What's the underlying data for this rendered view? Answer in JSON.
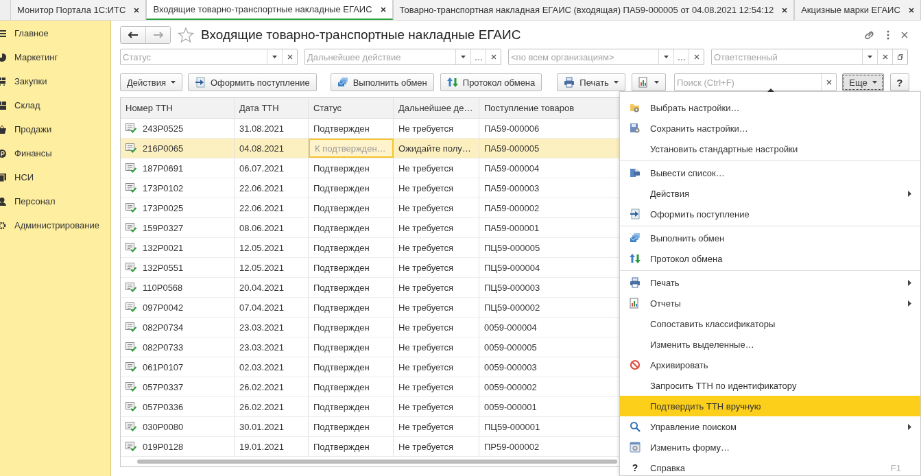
{
  "tabs": [
    {
      "label": "Монитор Портала 1С:ИТС",
      "selected": false
    },
    {
      "label": "Входящие товарно-транспортные накладные ЕГАИС",
      "selected": true
    },
    {
      "label": "Товарно-транспортная накладная ЕГАИС (входящая) ПА59-000005 от 04.08.2021 12:54:12",
      "selected": false
    },
    {
      "label": "Акцизные марки ЕГАИС",
      "selected": false
    }
  ],
  "sidebar": {
    "items": [
      {
        "label": "Главное"
      },
      {
        "label": "Маркетинг"
      },
      {
        "label": "Закупки"
      },
      {
        "label": "Склад"
      },
      {
        "label": "Продажи"
      },
      {
        "label": "Финансы"
      },
      {
        "label": "НСИ"
      },
      {
        "label": "Персонал"
      },
      {
        "label": "Администрирование"
      }
    ]
  },
  "form": {
    "title": "Входящие товарно-транспортные накладные ЕГАИС",
    "favorite": false
  },
  "filters": [
    {
      "placeholder": "Статус",
      "kind": "select"
    },
    {
      "placeholder": "Дальнейшее действие",
      "kind": "select_choose"
    },
    {
      "placeholder": "<по всем организациям>",
      "kind": "select_choose"
    },
    {
      "placeholder": "Ответственный",
      "kind": "select_open"
    }
  ],
  "toolbar": {
    "buttons": [
      {
        "label": "Действия",
        "dropdown": true
      },
      {
        "label": "Оформить поступление",
        "dropdown": false
      },
      {
        "label": "Выполнить обмен",
        "dropdown": false
      },
      {
        "label": "Протокол обмена",
        "dropdown": false
      },
      {
        "label": "Печать",
        "dropdown": true
      },
      {
        "dropdown": true
      }
    ],
    "search": {
      "placeholder": "Поиск (Ctrl+F)"
    },
    "more": {
      "label": "Еще",
      "pressed": true
    },
    "help": "?"
  },
  "table": {
    "columns": [
      "Номер ТТН",
      "Дата ТТН",
      "Статус",
      "Дальнейшее де…",
      "Поступление товаров"
    ],
    "rows": [
      {
        "number": "243Р0525",
        "date": "31.08.2021",
        "status": "Подтвержден",
        "action": "Не требуется",
        "receipt": "ПА59-000006",
        "selected": false,
        "status_focused": false
      },
      {
        "number": "216Р0065",
        "date": "04.08.2021",
        "status": "К подтвержден…",
        "action": "Ожидайте полу…",
        "receipt": "ПА59-000005",
        "selected": true,
        "status_focused": true
      },
      {
        "number": "187Р0691",
        "date": "06.07.2021",
        "status": "Подтвержден",
        "action": "Не требуется",
        "receipt": "ПА59-000004",
        "selected": false,
        "status_focused": false
      },
      {
        "number": "173Р0102",
        "date": "22.06.2021",
        "status": "Подтвержден",
        "action": "Не требуется",
        "receipt": "ПА59-000003",
        "selected": false,
        "status_focused": false
      },
      {
        "number": "173Р0025",
        "date": "22.06.2021",
        "status": "Подтвержден",
        "action": "Не требуется",
        "receipt": "ПА59-000002",
        "selected": false,
        "status_focused": false
      },
      {
        "number": "159Р0327",
        "date": "08.06.2021",
        "status": "Подтвержден",
        "action": "Не требуется",
        "receipt": "ПА59-000001",
        "selected": false,
        "status_focused": false
      },
      {
        "number": "132Р0021",
        "date": "12.05.2021",
        "status": "Подтвержден",
        "action": "Не требуется",
        "receipt": "ПЦ59-000005",
        "selected": false,
        "status_focused": false
      },
      {
        "number": "132Р0551",
        "date": "12.05.2021",
        "status": "Подтвержден",
        "action": "Не требуется",
        "receipt": "ПЦ59-000004",
        "selected": false,
        "status_focused": false
      },
      {
        "number": "110Р0568",
        "date": "20.04.2021",
        "status": "Подтвержден",
        "action": "Не требуется",
        "receipt": "ПЦ59-000003",
        "selected": false,
        "status_focused": false
      },
      {
        "number": "097Р0042",
        "date": "07.04.2021",
        "status": "Подтвержден",
        "action": "Не требуется",
        "receipt": "ПЦ59-000002",
        "selected": false,
        "status_focused": false
      },
      {
        "number": "082Р0734",
        "date": "23.03.2021",
        "status": "Подтвержден",
        "action": "Не требуется",
        "receipt": "0059-000004",
        "selected": false,
        "status_focused": false
      },
      {
        "number": "082Р0733",
        "date": "23.03.2021",
        "status": "Подтвержден",
        "action": "Не требуется",
        "receipt": "0059-000005",
        "selected": false,
        "status_focused": false
      },
      {
        "number": "061Р0107",
        "date": "02.03.2021",
        "status": "Подтвержден",
        "action": "Не требуется",
        "receipt": "0059-000003",
        "selected": false,
        "status_focused": false
      },
      {
        "number": "057Р0337",
        "date": "26.02.2021",
        "status": "Подтвержден",
        "action": "Не требуется",
        "receipt": "0059-000002",
        "selected": false,
        "status_focused": false
      },
      {
        "number": "057Р0336",
        "date": "26.02.2021",
        "status": "Подтвержден",
        "action": "Не требуется",
        "receipt": "0059-000001",
        "selected": false,
        "status_focused": false
      },
      {
        "number": "030Р0080",
        "date": "30.01.2021",
        "status": "Подтвержден",
        "action": "Не требуется",
        "receipt": "ПЦ59-000001",
        "selected": false,
        "status_focused": false
      },
      {
        "number": "019Р0128",
        "date": "19.01.2021",
        "status": "Подтвержден",
        "action": "Не требуется",
        "receipt": "ПР59-000002",
        "selected": false,
        "status_focused": false
      }
    ]
  },
  "menu": {
    "groups": [
      [
        {
          "label": "Выбрать настройки…",
          "selected": false,
          "submenu": false
        },
        {
          "label": "Сохранить настройки…",
          "selected": false,
          "submenu": false
        },
        {
          "label": "Установить стандартные настройки",
          "selected": false,
          "submenu": false
        }
      ],
      [
        {
          "label": "Вывести список…",
          "selected": false,
          "submenu": false
        },
        {
          "label": "Действия",
          "selected": false,
          "submenu": true
        },
        {
          "label": "Оформить поступление",
          "selected": false,
          "submenu": false
        }
      ],
      [
        {
          "label": "Выполнить обмен",
          "selected": false,
          "submenu": false
        },
        {
          "label": "Протокол обмена",
          "selected": false,
          "submenu": false
        }
      ],
      [
        {
          "label": "Печать",
          "selected": false,
          "submenu": true
        },
        {
          "label": "Отчеты",
          "selected": false,
          "submenu": true
        },
        {
          "label": "Сопоставить классификаторы",
          "selected": false,
          "submenu": false
        },
        {
          "label": "Изменить выделенные…",
          "selected": false,
          "submenu": false
        },
        {
          "label": "Архивировать",
          "selected": false,
          "submenu": false
        },
        {
          "label": "Запросить ТТН по идентификатору",
          "selected": false,
          "submenu": false
        },
        {
          "label": "Подтвердить ТТН вручную",
          "selected": true,
          "submenu": false
        },
        {
          "label": "Управление поиском",
          "selected": false,
          "submenu": true
        },
        {
          "label": "Изменить форму…",
          "selected": false,
          "submenu": false
        },
        {
          "label": "Справка",
          "selected": false,
          "submenu": false,
          "glyph": "?",
          "shortcut": "F1"
        }
      ]
    ]
  }
}
